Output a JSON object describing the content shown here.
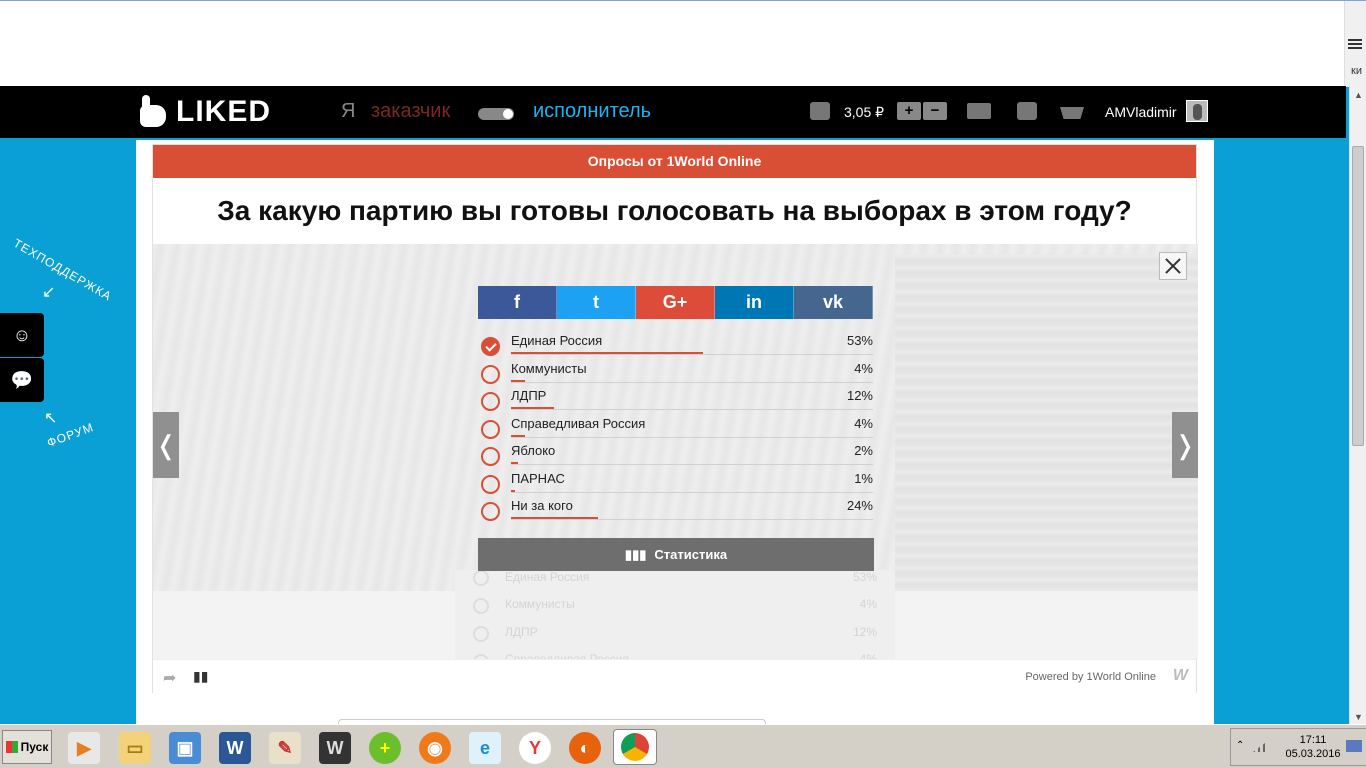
{
  "browser": {
    "edge_text": "ки"
  },
  "nav": {
    "logo": "LIKED",
    "role_prefix": "Я",
    "role_customer": "заказчик",
    "role_executor": "исполнитель",
    "balance": "3,05 ₽",
    "plus": "+",
    "minus": "−",
    "username": "AMVladimir"
  },
  "sidebar": {
    "support_label": "ТЕХПОДДЕРЖКА",
    "forum_label": "ФОРУМ"
  },
  "poll": {
    "header": "Опросы от 1World Online",
    "question": "За какую партию вы готовы голосовать на выборах в этом году?",
    "share": [
      "f",
      "t",
      "G+",
      "in",
      "vk"
    ],
    "results": [
      {
        "label": "Единая Россия",
        "pct": "53%",
        "value": 53,
        "checked": true
      },
      {
        "label": "Коммунисты",
        "pct": "4%",
        "value": 4,
        "checked": false
      },
      {
        "label": "ЛДПР",
        "pct": "12%",
        "value": 12,
        "checked": false
      },
      {
        "label": "Справедливая Россия",
        "pct": "4%",
        "value": 4,
        "checked": false
      },
      {
        "label": "Яблоко",
        "pct": "2%",
        "value": 2,
        "checked": false
      },
      {
        "label": "ПАРНАС",
        "pct": "1%",
        "value": 1,
        "checked": false
      },
      {
        "label": "Ни за кого",
        "pct": "24%",
        "value": 24,
        "checked": false
      }
    ],
    "stats_button": "Статистика",
    "ghost": [
      {
        "label": "Единая Россия",
        "pct": "53%"
      },
      {
        "label": "Коммунисты",
        "pct": "4%"
      },
      {
        "label": "ЛДПР",
        "pct": "12%"
      },
      {
        "label": "Справедливая Россия",
        "pct": "4%"
      }
    ],
    "prev": "❬",
    "next": "❭",
    "powered_by": "Powered by 1World Online",
    "brand_mark": "W"
  },
  "taskbar": {
    "start": "Пуск",
    "time": "17:11",
    "date": "05.03.2016"
  },
  "colors": {
    "accent": "#d94f36",
    "page_bg": "#0aa0d6",
    "nav_bg": "#000000"
  }
}
